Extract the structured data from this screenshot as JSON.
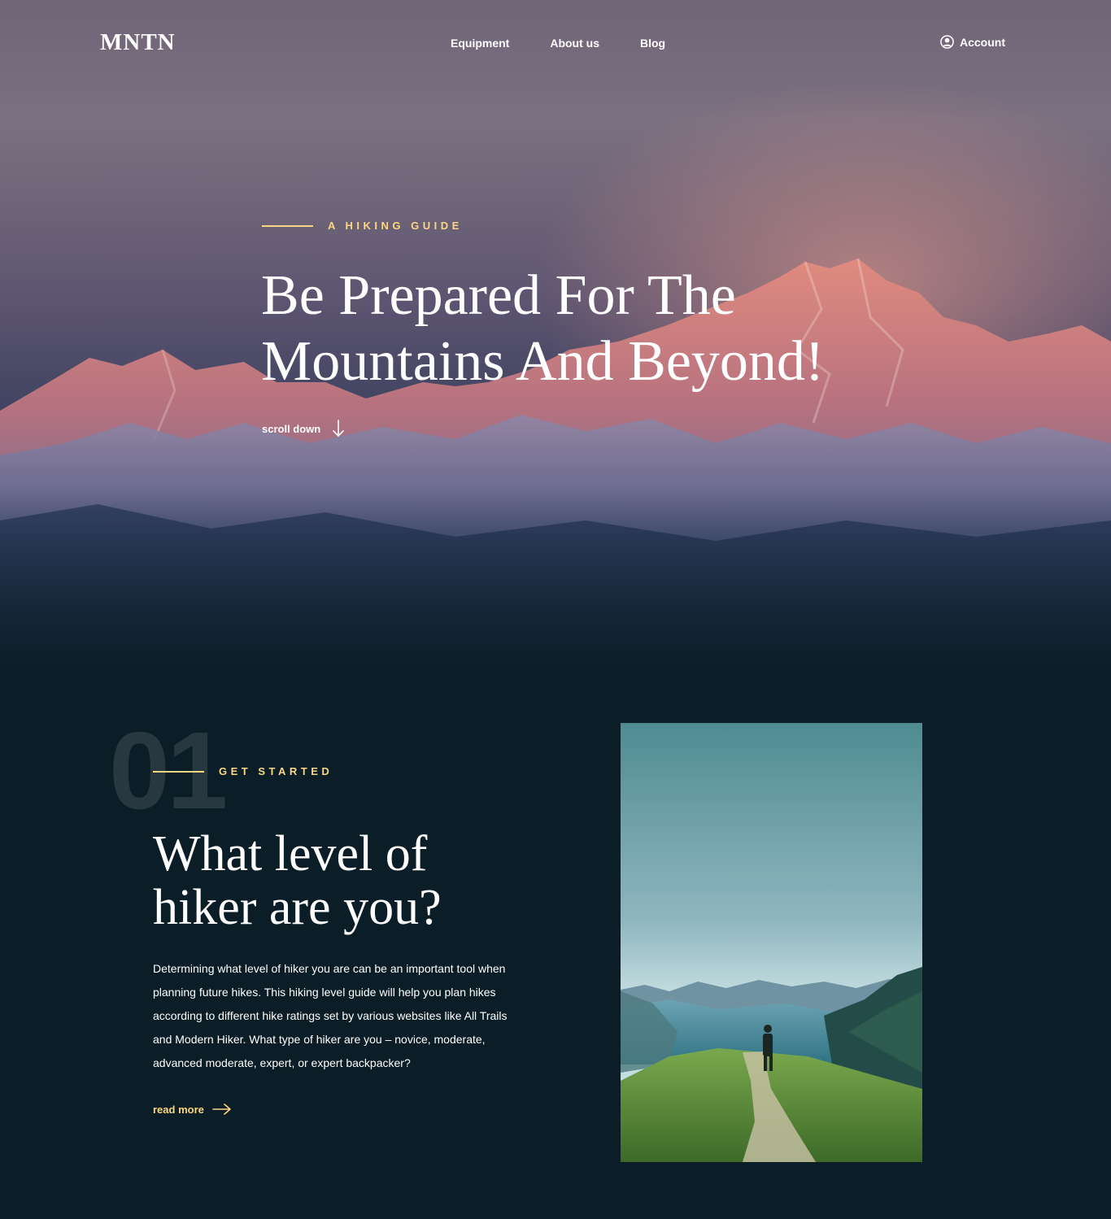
{
  "nav": {
    "logo": "MNTN",
    "links": [
      "Equipment",
      "About us",
      "Blog"
    ],
    "account_label": "Account"
  },
  "hero": {
    "eyebrow": "A HIKING GUIDE",
    "title": "Be Prepared For The Mountains And Beyond!",
    "scroll_label": "scroll down"
  },
  "section1": {
    "number": "01",
    "eyebrow": "GET STARTED",
    "title": "What level of hiker are you?",
    "body": "Determining what level of hiker you are can be an important tool when planning future hikes. This hiking level guide will help you plan hikes according to different hike ratings set by various websites like All Trails and Modern Hiker. What type of hiker are you – novice, moderate, advanced moderate, expert, or expert backpacker?",
    "read_more": "read more"
  },
  "colors": {
    "accent": "#fbd784",
    "background": "#0b1d26"
  },
  "icons": {
    "account": "user-circle-icon",
    "scroll": "arrow-down-icon",
    "read_more": "arrow-right-icon"
  }
}
